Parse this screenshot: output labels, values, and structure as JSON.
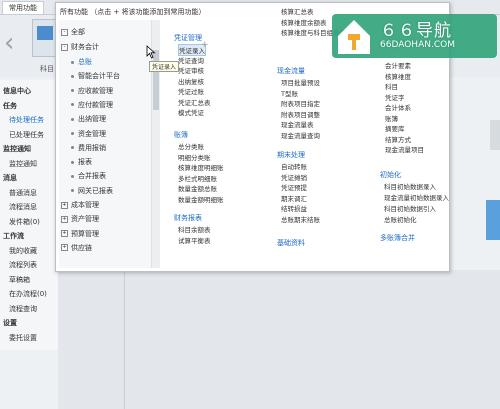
{
  "top_tab": "常用功能",
  "banner": {
    "app_label": "科目"
  },
  "sidebar": {
    "items": [
      {
        "label": "信息中心",
        "type": "head"
      },
      {
        "label": "任务",
        "type": "head"
      },
      {
        "label": "待处理任务",
        "type": "blue"
      },
      {
        "label": "已处理任务",
        "type": "normal"
      },
      {
        "label": "监控通知",
        "type": "head"
      },
      {
        "label": "监控通知",
        "type": "normal"
      },
      {
        "label": "消息",
        "type": "head"
      },
      {
        "label": "普通消息",
        "type": "normal"
      },
      {
        "label": "流程消息",
        "type": "normal"
      },
      {
        "label": "发件箱(0)",
        "type": "normal"
      },
      {
        "label": "工作流",
        "type": "head"
      },
      {
        "label": "我的收藏",
        "type": "normal"
      },
      {
        "label": "流程列表",
        "type": "normal"
      },
      {
        "label": "草稿箱",
        "type": "normal"
      },
      {
        "label": "在办流程(0)",
        "type": "normal"
      },
      {
        "label": "流程查询",
        "type": "normal"
      },
      {
        "label": "设置",
        "type": "head"
      },
      {
        "label": "委托设置",
        "type": "normal"
      }
    ]
  },
  "popup": {
    "title": "所有功能  （点击 + 将该功能添加到常用功能）",
    "tree": [
      {
        "label": "全部",
        "level": 0,
        "box": "-"
      },
      {
        "label": "财务会计",
        "level": 0,
        "box": "-"
      },
      {
        "label": "总账",
        "level": 1,
        "active": true
      },
      {
        "label": "智能会计平台",
        "level": 1
      },
      {
        "label": "应收款管理",
        "level": 1
      },
      {
        "label": "应付款管理",
        "level": 1
      },
      {
        "label": "出纳管理",
        "level": 1
      },
      {
        "label": "资金管理",
        "level": 1
      },
      {
        "label": "费用报销",
        "level": 1
      },
      {
        "label": "报表",
        "level": 1
      },
      {
        "label": "合并报表",
        "level": 1
      },
      {
        "label": "网关已报表",
        "level": 1
      },
      {
        "label": "成本管理",
        "level": 0,
        "box": "+"
      },
      {
        "label": "资产管理",
        "level": 0,
        "box": "+"
      },
      {
        "label": "预算管理",
        "level": 0,
        "box": "+"
      },
      {
        "label": "供应链",
        "level": 0,
        "box": "+"
      }
    ],
    "groups": [
      {
        "title": "凭证管理",
        "items": [
          "凭证录入",
          "凭证查询",
          "凭证审核",
          "出纳复核",
          "凭证过账",
          "凭证汇总表",
          "模式凭证"
        ]
      },
      {
        "title": "账簿",
        "items": [
          "总分类账",
          "明细分类账",
          "核算维度明细账",
          "多栏式明细账",
          "数量金额总账",
          "数量金额明细账"
        ]
      },
      {
        "title": "财务报表",
        "items": [
          "科目余额表",
          "试算平衡表"
        ]
      },
      {
        "title": "",
        "items": [
          "核算汇总表",
          "核算维度余额表",
          "核算维度与科目组合表"
        ]
      },
      {
        "title": "现金流量",
        "items": [
          "项目批量预设",
          "T型账",
          "附表项目指定",
          "附表项目调整",
          "现金流量表",
          "现金流量查询"
        ]
      },
      {
        "title": "期末处理",
        "items": [
          "自动转账",
          "凭证摊销",
          "凭证预提",
          "期末调汇",
          "结转损益",
          "总账期末结账"
        ]
      },
      {
        "title": "基础资料",
        "items": []
      },
      {
        "title": "",
        "items": [
          "会计要素",
          "核算维度",
          "科目",
          "凭证字",
          "会计体系",
          "账簿",
          "摘要库",
          "结算方式",
          "现金流量项目"
        ]
      },
      {
        "title": "初始化",
        "items": [
          "科目初始数据录入",
          "现金流量初始数据录入",
          "科目初始数据引入",
          "总账初始化"
        ]
      },
      {
        "title": "多账簿合并",
        "items": []
      }
    ],
    "tooltip": "凭证录入"
  },
  "watermark": {
    "title": "６６导航",
    "url": "66DAOHAN.COM"
  }
}
